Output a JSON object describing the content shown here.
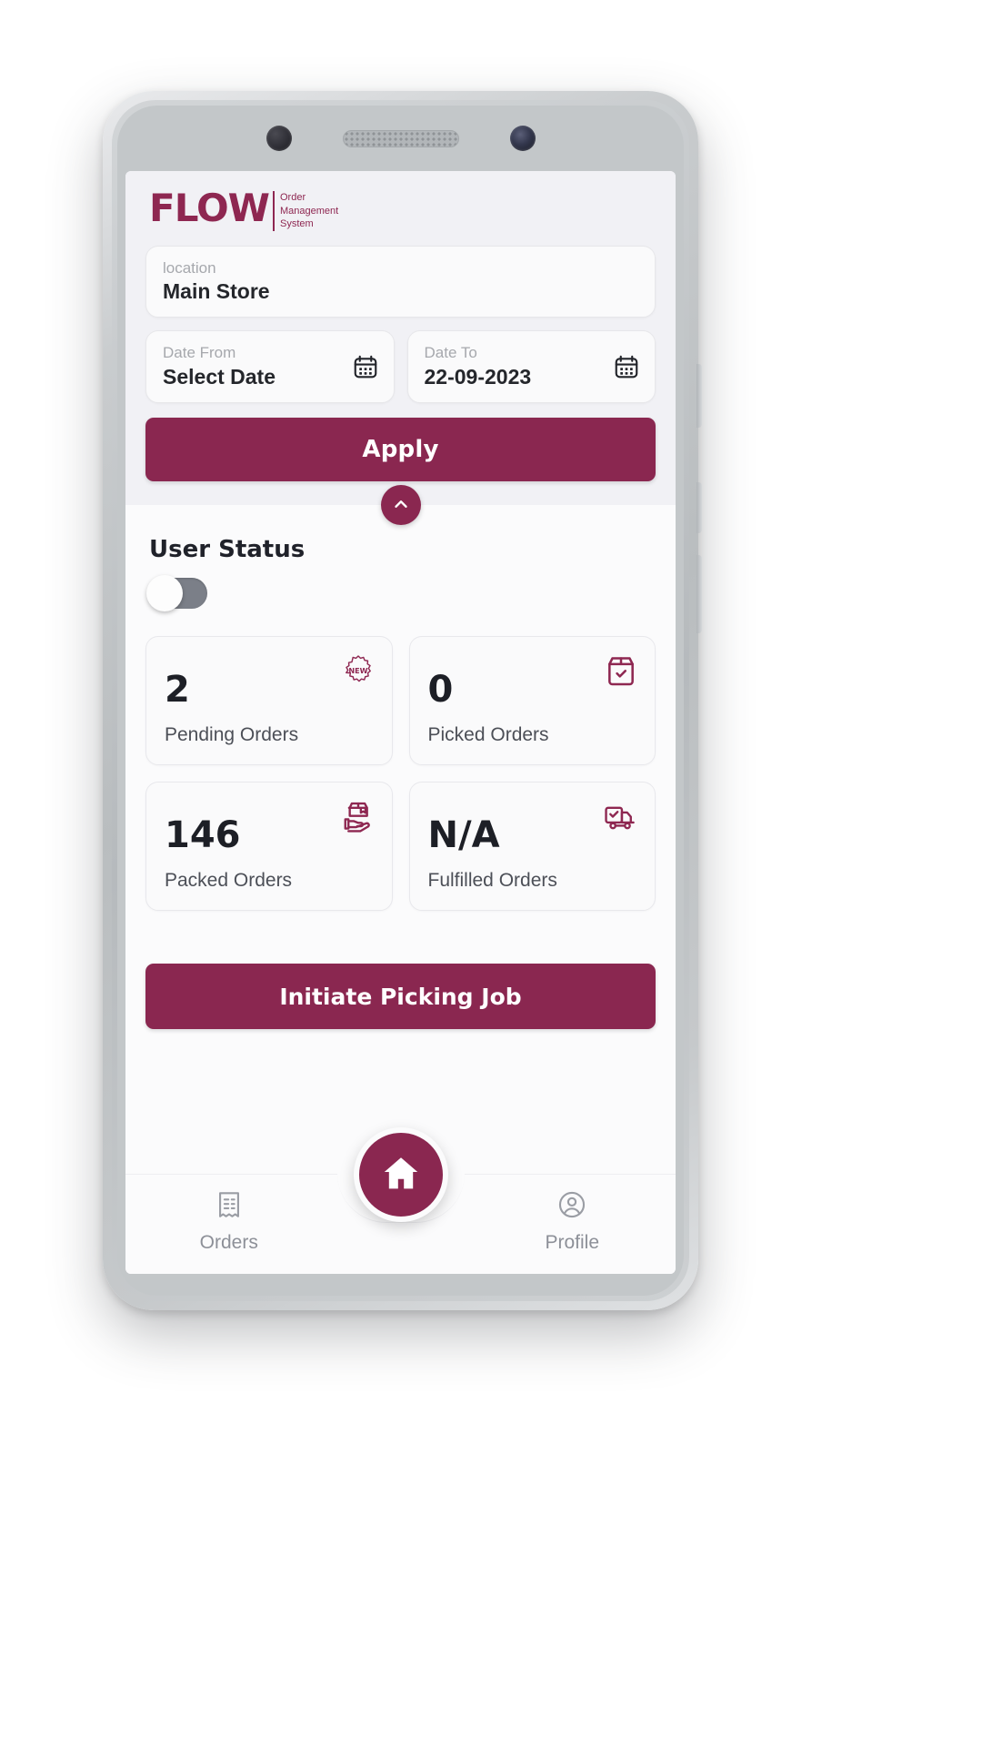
{
  "brand": {
    "name": "FLOW",
    "sub_line1": "Order",
    "sub_line2": "Management",
    "sub_line3": "System",
    "color": "#8E2751"
  },
  "filters": {
    "location": {
      "label": "location",
      "value": "Main Store"
    },
    "date_from": {
      "label": "Date From",
      "value": "Select Date",
      "icon": "calendar-icon"
    },
    "date_to": {
      "label": "Date To",
      "value": "22-09-2023",
      "icon": "calendar-icon"
    },
    "apply_label": "Apply",
    "collapse_icon": "chevron-up-icon"
  },
  "user_status": {
    "title": "User Status",
    "toggle_on": false
  },
  "stats": [
    {
      "value": "2",
      "label": "Pending Orders",
      "icon": "new-badge-icon"
    },
    {
      "value": "0",
      "label": "Picked Orders",
      "icon": "box-check-icon"
    },
    {
      "value": "146",
      "label": "Packed Orders",
      "icon": "hand-package-icon"
    },
    {
      "value": "N/A",
      "label": "Fulfilled Orders",
      "icon": "truck-check-icon"
    }
  ],
  "primary_action": {
    "label": "Initiate Picking Job"
  },
  "bottom_nav": {
    "orders": {
      "label": "Orders",
      "icon": "receipt-icon"
    },
    "home": {
      "icon": "home-icon"
    },
    "profile": {
      "label": "Profile",
      "icon": "user-circle-icon"
    }
  },
  "theme": {
    "accent": "#8A2750",
    "screen_bg": "#fbfbfc",
    "panel_bg": "#f1f1f5"
  }
}
